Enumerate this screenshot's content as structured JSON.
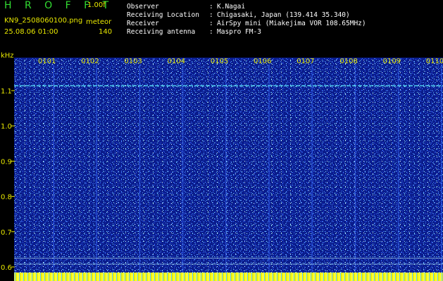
{
  "header": {
    "app_title": "H R O F F T",
    "version": "1.00f",
    "file_name": "KN9_2508060100.png",
    "mode": "meteor",
    "date_time": "25.08.06 01:00",
    "sample_count": "140"
  },
  "info": [
    {
      "label": "Observer",
      "value": "K.Nagai"
    },
    {
      "label": "Receiving Location",
      "value": "Chigasaki, Japan (139.414 35.340)"
    },
    {
      "label": "Receiver",
      "value": "AirSpy mini (Miakejima VOR 108.65MHz)"
    },
    {
      "label": "Receiving antenna",
      "value": "Maspro FM-3"
    }
  ],
  "info_separator": ":",
  "plot": {
    "y_unit": "kHz",
    "y_ticks": [
      "1.1",
      "1.0",
      "0.9",
      "0.8",
      "0.7",
      "0.6"
    ],
    "y_range": [
      0.58,
      1.18
    ],
    "x_ticks": [
      "0101",
      "0102",
      "0103",
      "0104",
      "0105",
      "0106",
      "0107",
      "0108",
      "0109",
      "0110"
    ],
    "colors": {
      "background": "#0a1c8c",
      "noise_light": "#4a8cff",
      "noise_bright": "#7fe6ff",
      "grid_line": "#b4e6ff",
      "tick_text": "#e8e800",
      "bottom_strip": "#ffff30"
    },
    "horizontal_lines_khz": [
      1.114,
      0.625,
      0.608
    ],
    "vertical_lines": 10
  }
}
